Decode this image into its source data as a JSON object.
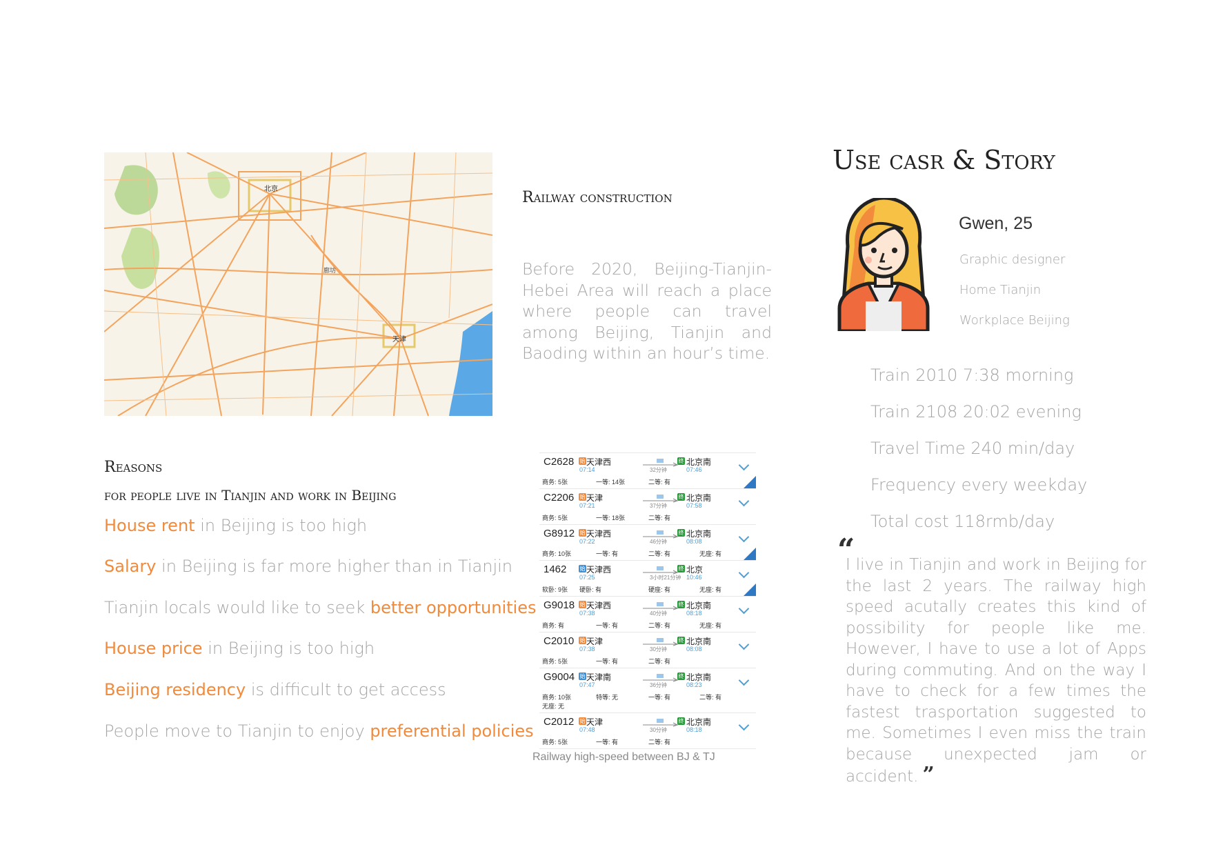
{
  "map": {
    "labels": [
      "北京",
      "天津",
      "廊坊"
    ]
  },
  "railway": {
    "heading": "Railway construction",
    "body": "Before 2020, Beijing-Tianjin-Hebei Area will reach a place where people can travel among Beijing, Tianjin and Baoding within an hour’s time."
  },
  "reasons": {
    "title": "Reasons",
    "subtitle": "for people live in Tianjin and work in Beijing",
    "items": [
      {
        "highlight": "House rent",
        "rest": " in Beijing is too high",
        "order": "hl-first"
      },
      {
        "highlight": "Salary",
        "rest": " in Beijing is far more higher than in Tianjin",
        "order": "hl-first"
      },
      {
        "highlight": "better opportunities",
        "rest": "Tianjin locals would like to seek ",
        "order": "hl-last"
      },
      {
        "highlight": "House price",
        "rest": " in Beijing is too high",
        "order": "hl-first"
      },
      {
        "highlight": "Beijing residency",
        "rest": " is difficult to get access",
        "order": "hl-first"
      },
      {
        "highlight": "preferential policies",
        "rest": "People move to Tianjin to enjoy ",
        "order": "hl-last"
      }
    ]
  },
  "schedule": {
    "caption": "Railway high-speed between BJ & TJ",
    "trains": [
      {
        "no": "C2628",
        "from": "天津西",
        "dep": "07:14",
        "dur": "32分钟",
        "to": "北京南",
        "arr": "07:46",
        "s1": "商务: 5张",
        "s2": "一等: 14张",
        "s3": "二等: 有",
        "s4": "",
        "corner": true
      },
      {
        "no": "C2206",
        "from": "天津",
        "dep": "07:21",
        "dur": "37分钟",
        "to": "北京南",
        "arr": "07:58",
        "s1": "商务: 5张",
        "s2": "一等: 18张",
        "s3": "二等: 有",
        "s4": "",
        "corner": false
      },
      {
        "no": "G8912",
        "from": "天津西",
        "dep": "07:22",
        "dur": "46分钟",
        "to": "北京南",
        "arr": "08:08",
        "s1": "商务: 10张",
        "s2": "一等: 有",
        "s3": "二等: 有",
        "s4": "无座: 有",
        "corner": true
      },
      {
        "no": "1462",
        "from": "天津西",
        "dep": "07:25",
        "dur": "3小时21分钟",
        "to": "北京",
        "arr": "10:46",
        "s1": "软卧: 9张",
        "s2": "硬卧: 有",
        "s3": "硬座: 有",
        "s4": "无座: 有",
        "corner": true
      },
      {
        "no": "G9018",
        "from": "天津西",
        "dep": "07:38",
        "dur": "40分钟",
        "to": "北京南",
        "arr": "08:18",
        "s1": "商务: 有",
        "s2": "一等: 有",
        "s3": "二等: 有",
        "s4": "无座: 有",
        "corner": false
      },
      {
        "no": "C2010",
        "from": "天津",
        "dep": "07:38",
        "dur": "30分钟",
        "to": "北京南",
        "arr": "08:08",
        "s1": "商务: 5张",
        "s2": "一等: 有",
        "s3": "二等: 有",
        "s4": "",
        "corner": false
      },
      {
        "no": "G9004",
        "from": "天津南",
        "dep": "07:47",
        "dur": "36分钟",
        "to": "北京南",
        "arr": "08:23",
        "s1": "商务: 10张",
        "s2": "特等: 无",
        "s3": "一等: 有",
        "s4": "二等: 有",
        "s5": "无座: 无",
        "corner": false
      },
      {
        "no": "C2012",
        "from": "天津",
        "dep": "07:48",
        "dur": "30分钟",
        "to": "北京南",
        "arr": "08:18",
        "s1": "商务: 5张",
        "s2": "一等: 有",
        "s3": "二等: 有",
        "s4": "",
        "corner": false
      }
    ]
  },
  "story": {
    "title": "Use casr & Story",
    "name": "Gwen, 25",
    "role": "Graphic designer",
    "home": "Home Tianjin",
    "work": "Workplace Beijing",
    "facts": [
      "Train 2010 7:38 morning",
      "Train 2108 20:02 evening",
      "Travel Time 240 min/day",
      "Frequency every weekday",
      "Total cost 118rmb/day"
    ],
    "open_quote": "“",
    "close_quote": "”",
    "quote": "I live in Tianjin and work in Beijing for the last 2 years. The railway high speed acutally creates this kind of possibility for people like me. However, I have to use a lot of Apps during commuting. And on the way I have to check for a few times the fastest trasportation suggested to me. Sometimes I even miss the train because unexpected jam or accident."
  },
  "colors": {
    "accent": "#f08a3c",
    "text_gray": "#a4a4a4",
    "map_road": "#f4a35c",
    "sea": "#5aa9e6"
  }
}
